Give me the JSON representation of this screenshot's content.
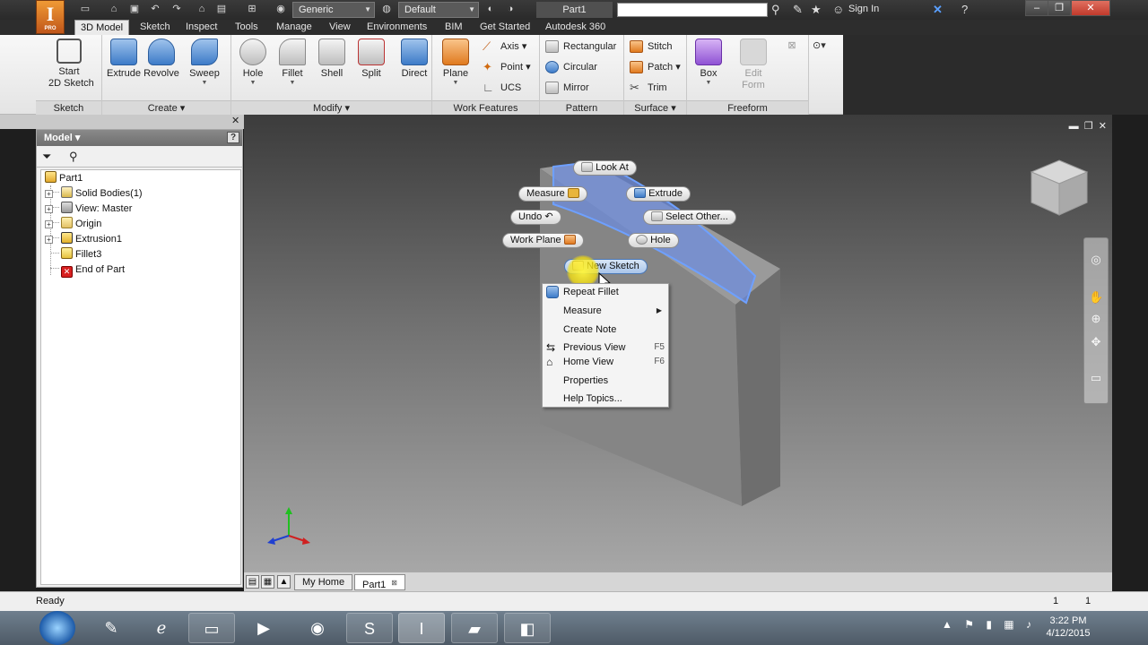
{
  "app": {
    "logo_letter": "I",
    "logo_badge": "PRO"
  },
  "titlebar": {
    "appearance": "Generic",
    "material": "Default",
    "document": "Part1",
    "search_placeholder": "",
    "sign_in": "Sign In"
  },
  "ribbon_tabs": [
    "3D Model",
    "Sketch",
    "Inspect",
    "Tools",
    "Manage",
    "View",
    "Environments",
    "BIM",
    "Get Started",
    "Autodesk 360"
  ],
  "ribbon": {
    "sketch": {
      "title": "Sketch",
      "start_sketch": "Start\n2D Sketch"
    },
    "create": {
      "title": "Create",
      "extrude": "Extrude",
      "revolve": "Revolve",
      "sweep": "Sweep"
    },
    "modify": {
      "title": "Modify",
      "hole": "Hole",
      "fillet": "Fillet",
      "shell": "Shell",
      "split": "Split",
      "direct": "Direct"
    },
    "work_features": {
      "title": "Work Features",
      "plane": "Plane",
      "axis": "Axis",
      "point": "Point",
      "ucs": "UCS"
    },
    "pattern": {
      "title": "Pattern",
      "rectangular": "Rectangular",
      "circular": "Circular",
      "mirror": "Mirror"
    },
    "surface": {
      "title": "Surface",
      "stitch": "Stitch",
      "patch": "Patch",
      "trim": "Trim"
    },
    "freeform": {
      "title": "Freeform",
      "box": "Box",
      "edit_form": "Edit\nForm"
    }
  },
  "browser": {
    "title": "Model",
    "help": "?",
    "tree": [
      {
        "label": "Part1"
      },
      {
        "label": "Solid Bodies(1)"
      },
      {
        "label": "View: Master"
      },
      {
        "label": "Origin"
      },
      {
        "label": "Extrusion1"
      },
      {
        "label": "Fillet3"
      },
      {
        "label": "End of Part"
      }
    ]
  },
  "marking_menu": {
    "look_at": "Look At",
    "measure": "Measure",
    "extrude": "Extrude",
    "undo": "Undo",
    "select_other": "Select Other...",
    "work_plane": "Work Plane",
    "hole": "Hole",
    "new_sketch": "New Sketch"
  },
  "context_menu": [
    {
      "label": "Repeat Fillet",
      "shortcut": ""
    },
    {
      "label": "Measure",
      "shortcut": ""
    },
    {
      "label": "Create Note",
      "shortcut": ""
    },
    {
      "label": "Previous View",
      "shortcut": "F5"
    },
    {
      "label": "Home View",
      "shortcut": "F6"
    },
    {
      "label": "Properties",
      "shortcut": ""
    },
    {
      "label": "Help Topics...",
      "shortcut": ""
    }
  ],
  "doc_tabs": {
    "home": "My Home",
    "part": "Part1"
  },
  "status": {
    "text": "Ready",
    "count1": "1",
    "count2": "1"
  },
  "clock": {
    "time": "3:22 PM",
    "date": "4/12/2015"
  },
  "colors": {
    "accent_blue": "#4a78b7",
    "orange": "#e07a1f",
    "viewport_top": "#3c3c3c",
    "viewport_bottom": "#a7a7a7"
  }
}
